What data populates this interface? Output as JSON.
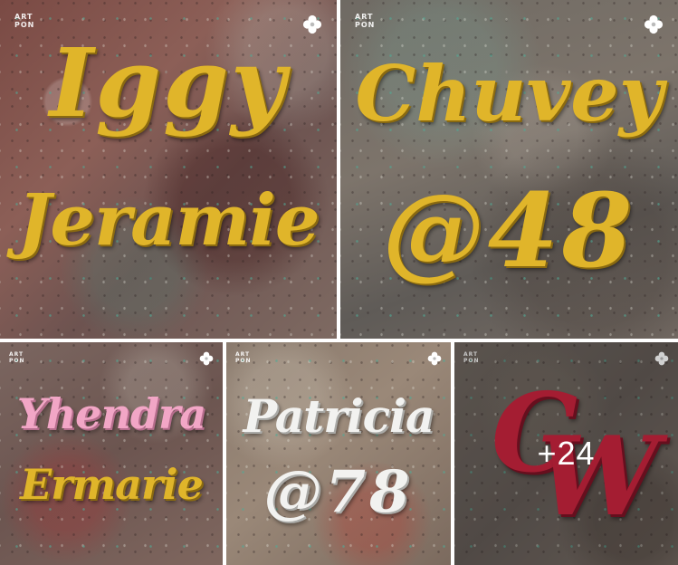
{
  "watermark": {
    "line1": "ART",
    "line2": "PON"
  },
  "tiles": [
    {
      "line1": "Iggy",
      "line2": "Jeramie"
    },
    {
      "line1": "Chuvey",
      "line2": "@48"
    },
    {
      "line1": "Yhendra",
      "line2": "Ermarie"
    },
    {
      "line1": "Patricia",
      "line2": "@78"
    },
    {
      "line1": "C",
      "line2": "W"
    }
  ],
  "more": {
    "count_label": "+24"
  },
  "colors": {
    "gold": "#e0b52a",
    "pink": "#f2a6c6",
    "white": "#f2f2f0",
    "red": "#c8243e",
    "divider": "#ffffff"
  },
  "icons": {
    "brand": "flower-icon"
  }
}
